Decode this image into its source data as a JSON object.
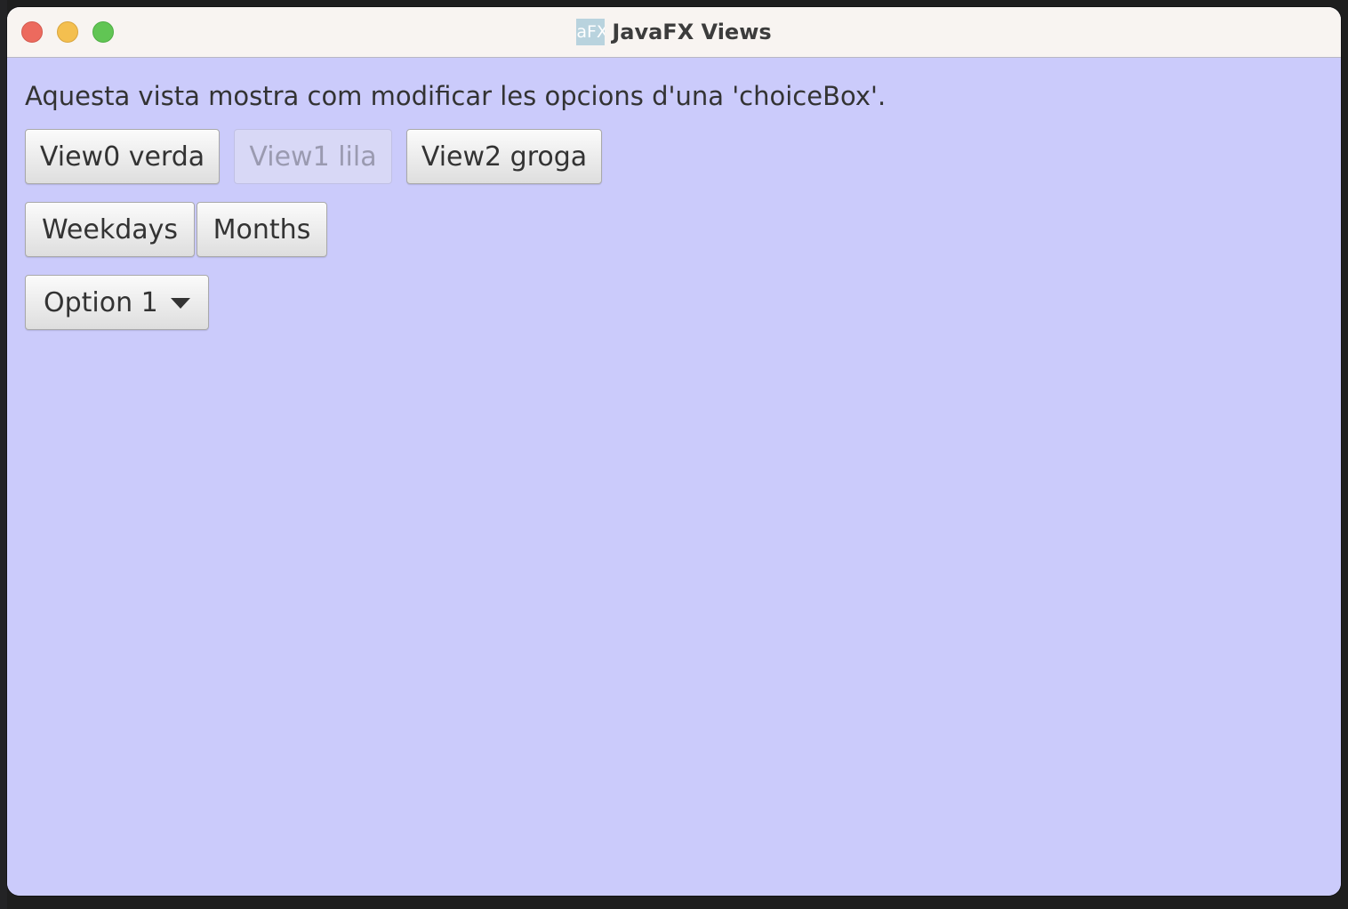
{
  "window": {
    "title": "JavaFX Views",
    "icon_text": "aFX"
  },
  "content": {
    "description": "Aquesta vista mostra com modificar les opcions d'una 'choiceBox'.",
    "view_buttons": [
      {
        "label": "View0 verda",
        "enabled": true
      },
      {
        "label": "View1 lila",
        "enabled": false
      },
      {
        "label": "View2 groga",
        "enabled": true
      }
    ],
    "list_buttons": [
      {
        "label": "Weekdays"
      },
      {
        "label": "Months"
      }
    ],
    "choice_box": {
      "selected": "Option 1"
    }
  },
  "colors": {
    "background": "#cbcbfb",
    "titlebar": "#f8f4f1",
    "close": "#ec6a5e",
    "minimize": "#f4bf4f",
    "maximize": "#61c554"
  },
  "icons": [
    "close-icon",
    "minimize-icon",
    "maximize-icon",
    "javafx-app-icon",
    "chevron-down-icon"
  ]
}
